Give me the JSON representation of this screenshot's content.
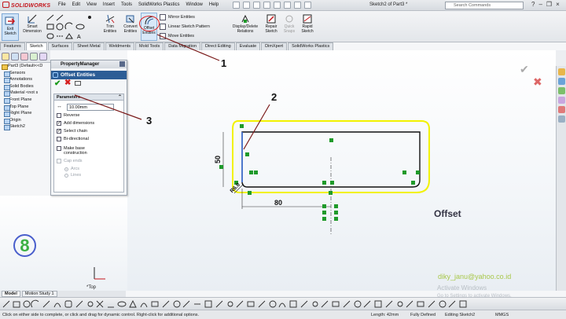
{
  "app": {
    "logo": "SOLIDWORKS",
    "document_title": "Sketch2 of Part3 *"
  },
  "menus": [
    "File",
    "Edit",
    "View",
    "Insert",
    "Tools",
    "SolidWorks Plastics",
    "Window",
    "Help"
  ],
  "search": {
    "placeholder": "Search Commands"
  },
  "ribbon": {
    "exit_sketch": "Exit Sketch",
    "smart_dimension": "Smart Dimension",
    "trim_entities": "Trim Entities",
    "convert_entities": "Convert Entities",
    "offset_entities": "Offset Entities",
    "mirror_entities": "Mirror Entities",
    "linear_pattern": "Linear Sketch Pattern",
    "move_entities": "Move Entities",
    "display_delete": "Display/Delete Relations",
    "repair_sketch": "Repair Sketch",
    "quick_snaps": "Quick Snaps",
    "rapid_sketch": "Rapid Sketch"
  },
  "command_tabs": [
    "Features",
    "Sketch",
    "Surfaces",
    "Sheet Metal",
    "Weldments",
    "Mold Tools",
    "Data Migration",
    "Direct Editing",
    "Evaluate",
    "DimXpert",
    "SolidWorks Plastics"
  ],
  "tree": {
    "root": "Part3 (Default<<D",
    "items": [
      "Sensors",
      "Annotations",
      "Solid Bodies",
      "Material <not s",
      "Front Plane",
      "Top Plane",
      "Right Plane",
      "Origin",
      "Sketch2"
    ]
  },
  "property_manager": {
    "header": "PropertyManager",
    "title": "Offset Entities",
    "section": "Parameters",
    "distance": "10.00mm",
    "options": [
      {
        "label": "Reverse",
        "checked": false,
        "enabled": true
      },
      {
        "label": "Add dimensions",
        "checked": true,
        "enabled": true
      },
      {
        "label": "Select chain",
        "checked": true,
        "enabled": true
      },
      {
        "label": "Bi-directional",
        "checked": false,
        "enabled": true
      },
      {
        "label": "Make base construction",
        "checked": false,
        "enabled": true
      },
      {
        "label": "Cap ends",
        "checked": false,
        "enabled": false
      }
    ],
    "cap_options": [
      "Arcs",
      "Lines"
    ]
  },
  "annotations": {
    "n1": "1",
    "n2": "2",
    "n3": "3",
    "step": "8"
  },
  "sketch": {
    "dim_height": "50",
    "dim_width": "80",
    "dim_radius": "R6.0"
  },
  "canvas": {
    "caption": "Offset",
    "email": "diky_janu@yahoo.co.id",
    "activate_title": "Activate Windows",
    "activate_sub": "Go to Settings to activate Windows.",
    "view_label": "*Top"
  },
  "bottom_tabs": [
    "Model",
    "Motion Study 1"
  ],
  "status": {
    "message": "Click on either side to complete, or click and drag for dynamic control.  Right-click for additional options.",
    "length": "Length: 42mm",
    "definition": "Fully Defined",
    "editing": "Editing Sketch2",
    "units": "MMGS"
  },
  "colors": {
    "offset_highlight": "#f2f200",
    "sketch_line": "#111111",
    "relation_green": "#1f9a2a",
    "accent_blue": "#2c5d96",
    "annotation_red": "#e02020"
  }
}
